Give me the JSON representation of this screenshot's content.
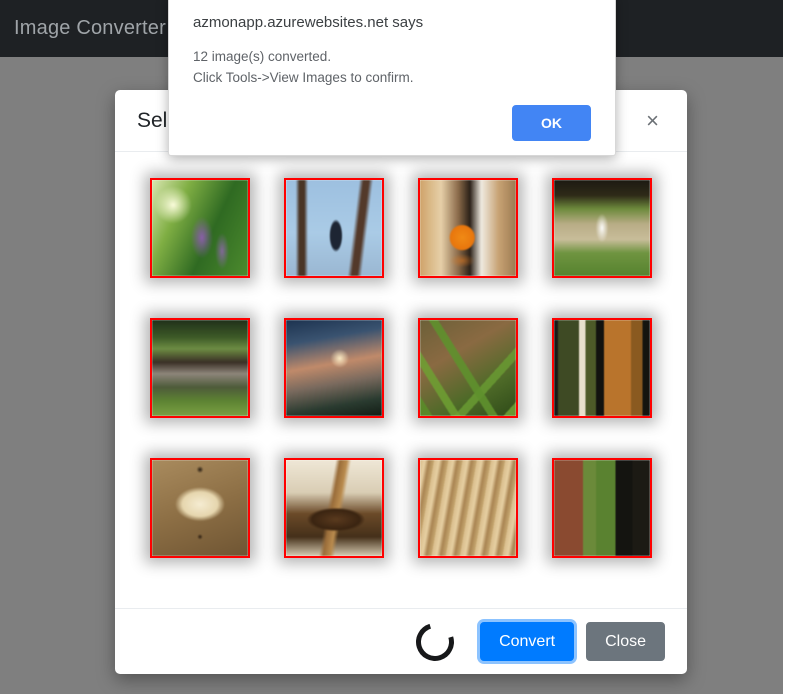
{
  "navbar": {
    "brand": "Image Converter"
  },
  "modal": {
    "title": "Select Images",
    "close_label": "×",
    "thumbnails": [
      {
        "name": "purple-flower-spike",
        "art": "art-flower"
      },
      {
        "name": "cormorant-bird-in-bare-tree",
        "art": "art-bird"
      },
      {
        "name": "orange-fruit-on-table",
        "art": "art-orange"
      },
      {
        "name": "garden-fountain-pond",
        "art": "art-fountain"
      },
      {
        "name": "woodland-pond-with-trees",
        "art": "art-pond"
      },
      {
        "name": "sunset-through-bare-trees",
        "art": "art-sunset"
      },
      {
        "name": "grass-and-leaf-litter",
        "art": "art-grass"
      },
      {
        "name": "grilled-food-on-plate",
        "art": "art-food"
      },
      {
        "name": "hanging-glass-lamp",
        "art": "art-lamp"
      },
      {
        "name": "wooden-stair-newel-post",
        "art": "art-knob"
      },
      {
        "name": "stack-of-books-edges",
        "art": "art-books"
      },
      {
        "name": "squirrel-by-brick-pillar",
        "art": "art-squirrel"
      }
    ],
    "footer": {
      "spinner_label": "loading-spinner",
      "convert_label": "Convert",
      "close_label": "Close"
    }
  },
  "alert": {
    "origin": "azmonapp.azurewebsites.net says",
    "message_line1": "12 image(s) converted.",
    "message_line2": "Click Tools->View Images to confirm.",
    "ok_label": "OK"
  },
  "colors": {
    "navbar_bg": "#1e2124",
    "navbar_text": "#9fa4a8",
    "backdrop": "rgba(0,0,0,0.5)",
    "thumb_border": "#ff0000",
    "convert_button": "#007bff",
    "close_button": "#6c757d",
    "alert_ok_button": "#4285f4"
  }
}
